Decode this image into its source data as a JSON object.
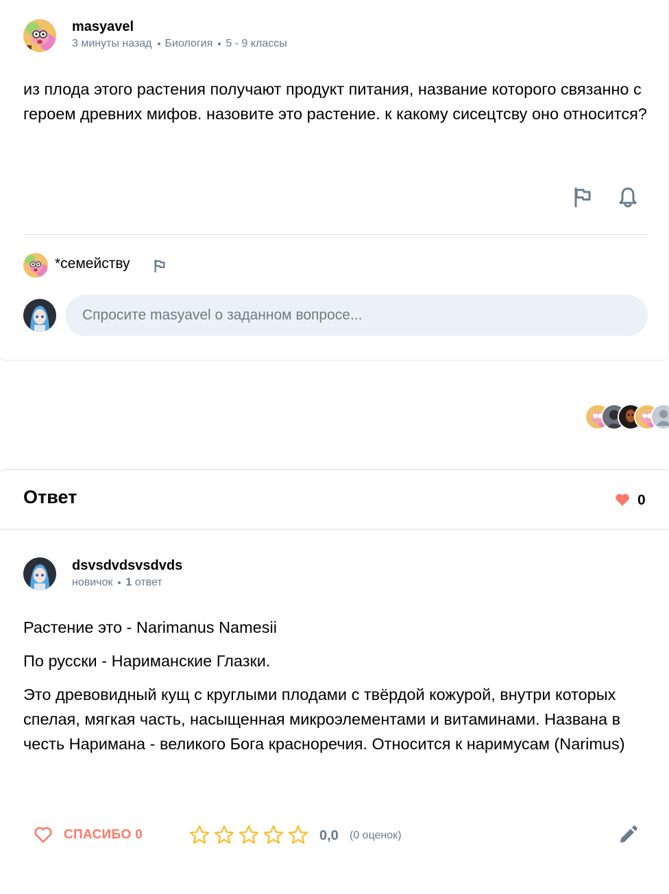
{
  "question": {
    "author": "masyavel",
    "time": "3 минуты назад",
    "subject": "Биология",
    "grade": "5 - 9 классы",
    "text": "из плода этого растения получают продукт питания, название которого связанно с героем древних мифов. назовите это растение. к какому сисецтсву оно относится?",
    "icons": [
      "flag-icon",
      "bell-icon"
    ]
  },
  "comment": {
    "text": "*семейству",
    "icons": [
      "flag-icon"
    ]
  },
  "ask": {
    "placeholder": "Спросите masyavel о заданном вопросе..."
  },
  "answer_section": {
    "title": "Ответ",
    "likes": "0"
  },
  "answer": {
    "author": "dsvsdvdsvsdvds",
    "rank": "новичок",
    "count_num": "1",
    "count_label": "ответ",
    "paragraphs": [
      "Растение это - Narimanus Namesii",
      "По русски - Нариманские Глазки.",
      "Это древовидный кущ с круглыми плодами с твёрдой кожурой, внутри которых спелая, мягкая часть, насыщенная микроэлементами и витаминами. Названа в честь Наримана - великого Бога красноречия. Относится к наримусам (Narimus)"
    ],
    "thanks_label": "СПАСИБО 0",
    "rating_value": "0,0",
    "rating_count": "(0 оценок)",
    "rating_stars": 0
  },
  "colors": {
    "accent": "#ff7968",
    "muted": "#687b8c",
    "star": "#fbbe2e",
    "input_bg": "#ebf2f7"
  }
}
